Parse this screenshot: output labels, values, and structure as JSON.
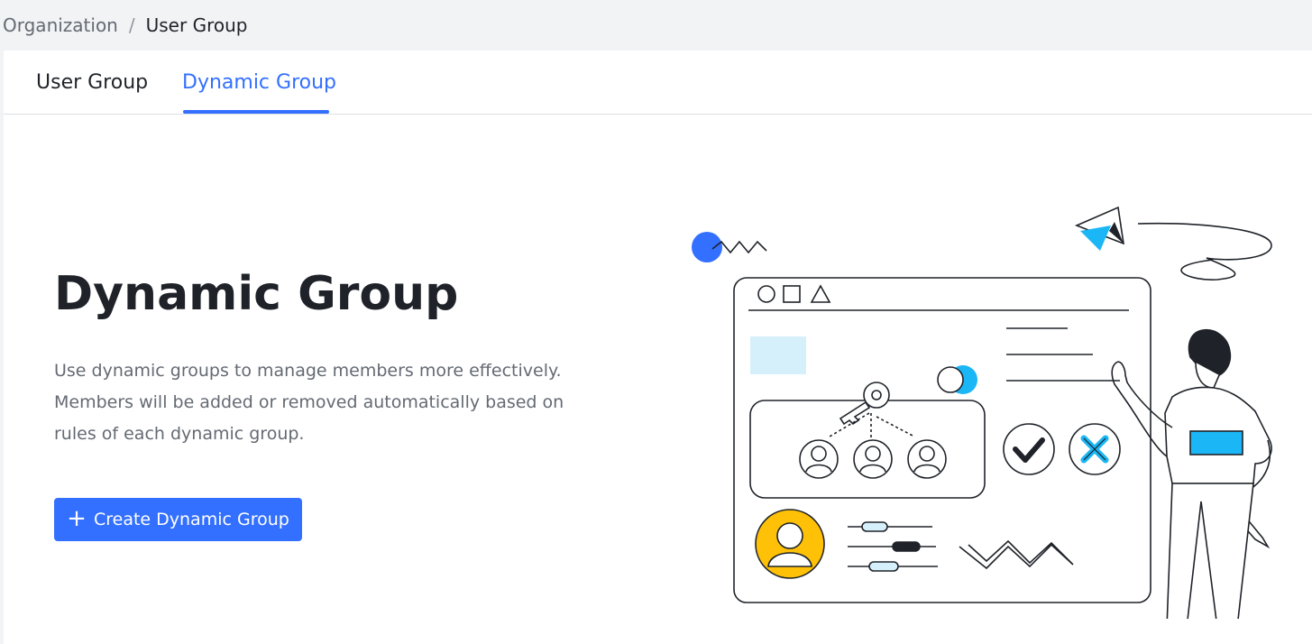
{
  "breadcrumb": {
    "parent": "Organization",
    "separator": "/",
    "current": "User Group"
  },
  "tabs": [
    {
      "label": "User Group",
      "active": false
    },
    {
      "label": "Dynamic Group",
      "active": true
    }
  ],
  "hero": {
    "title": "Dynamic Group",
    "description": "Use dynamic groups to manage members more effectively. Members will be added or removed automatically based on rules of each dynamic group.",
    "create_button": {
      "icon": "plus-icon",
      "label": "Create Dynamic Group"
    }
  },
  "colors": {
    "accent": "#3370ff",
    "text_primary": "#1f2329",
    "text_secondary": "#646a73",
    "illustration_blue": "#1ab6f5",
    "illustration_yellow": "#ffc107"
  }
}
